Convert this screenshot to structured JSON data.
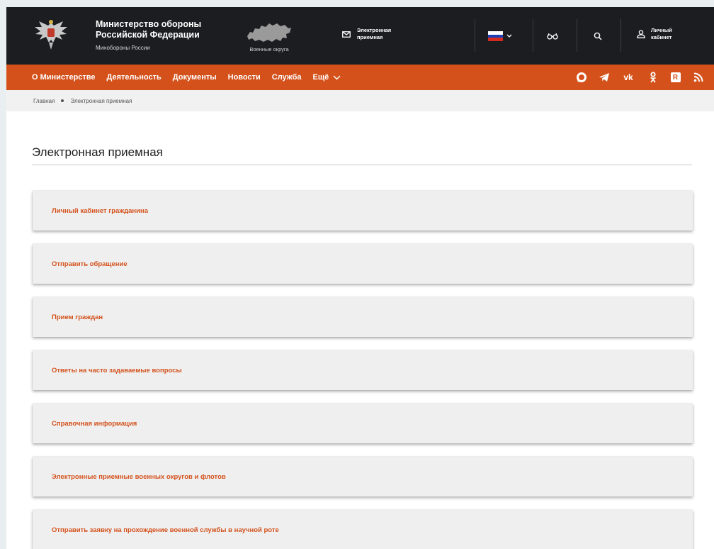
{
  "header": {
    "org_title": "Министерство обороны Российской Федерации",
    "org_subtitle": "Минобороны России",
    "districts_label": "Военные округа",
    "reception_label": "Электронная приемная",
    "account_label": "Личный кабинет",
    "icons": {
      "emblem": "double-eagle-emblem-icon",
      "map": "russia-map-icon",
      "reception": "envelope-icon",
      "lang": "russian-flag-icon",
      "accessibility": "glasses-icon",
      "search": "search-icon",
      "account": "user-icon"
    }
  },
  "nav": {
    "items": [
      "О Министерстве",
      "Деятельность",
      "Документы",
      "Новости",
      "Служба"
    ],
    "more_label": "Ещё",
    "social": [
      "max-icon",
      "telegram-icon",
      "vk-icon",
      "odnoklassniki-icon",
      "rutube-icon",
      "rss-icon"
    ],
    "social_glyphs": {
      "vk": "vk",
      "rutube": "R"
    }
  },
  "breadcrumb": {
    "home": "Главная",
    "current": "Электронная приемная"
  },
  "page": {
    "title": "Электронная приемная"
  },
  "accordion": [
    "Личный кабинет гражданина",
    "Отправить обращение",
    "Прием граждан",
    "Ответы на часто задаваемые вопросы",
    "Справочная информация",
    "Электронные приемные военных округов и флотов",
    "Отправить заявку на прохождение военной службы в научной роте"
  ],
  "colors": {
    "header_bg": "#1b1d21",
    "nav_bg": "#d4511b",
    "accent": "#d4511b",
    "flag_white": "#ffffff",
    "flag_blue": "#1c3fb8",
    "flag_red": "#d52b1e"
  }
}
